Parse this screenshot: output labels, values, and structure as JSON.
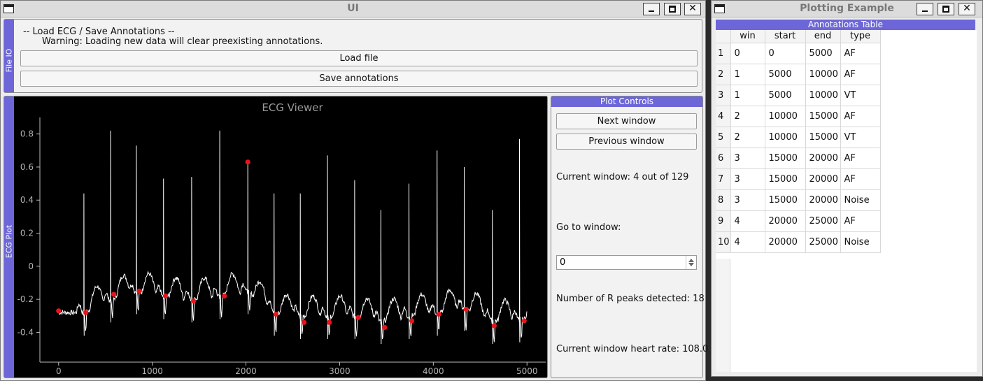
{
  "main_window": {
    "title": "UI",
    "buttons": {
      "minimize": "minimize",
      "maximize": "maximize",
      "close": "✕"
    }
  },
  "file_io": {
    "dock_title": "File IO",
    "heading": "-- Load ECG / Save Annotations --",
    "warning": "Warning: Loading new data will clear preexisting annotations.",
    "load_button": "Load file",
    "save_button": "Save annotations"
  },
  "ecg_dock": {
    "dock_title": "ECG Plot"
  },
  "plot_controls": {
    "title": "Plot Controls",
    "next_button": "Next window",
    "prev_button": "Previous window",
    "current_window": "Current window: 4 out of 129",
    "goto_label": "Go to window:",
    "goto_value": "0",
    "r_peaks": "Number of R peaks detected: 18",
    "heart_rate": "Current window heart rate: 108.0"
  },
  "side_window": {
    "title": "Plotting Example",
    "buttons": {
      "minimize": "minimize",
      "maximize": "maximize",
      "close": "✕"
    },
    "table_title": "Annotations Table",
    "columns": [
      "win",
      "start",
      "end",
      "type"
    ],
    "rows": [
      {
        "num": "1",
        "win": "0",
        "start": "0",
        "end": "5000",
        "type": "AF"
      },
      {
        "num": "2",
        "win": "1",
        "start": "5000",
        "end": "10000",
        "type": "AF"
      },
      {
        "num": "3",
        "win": "1",
        "start": "5000",
        "end": "10000",
        "type": "VT"
      },
      {
        "num": "4",
        "win": "2",
        "start": "10000",
        "end": "15000",
        "type": "AF"
      },
      {
        "num": "5",
        "win": "2",
        "start": "10000",
        "end": "15000",
        "type": "VT"
      },
      {
        "num": "6",
        "win": "3",
        "start": "15000",
        "end": "20000",
        "type": "AF"
      },
      {
        "num": "7",
        "win": "3",
        "start": "15000",
        "end": "20000",
        "type": "AF"
      },
      {
        "num": "8",
        "win": "3",
        "start": "15000",
        "end": "20000",
        "type": "Noise"
      },
      {
        "num": "9",
        "win": "4",
        "start": "20000",
        "end": "25000",
        "type": "AF"
      },
      {
        "num": "10",
        "win": "4",
        "start": "20000",
        "end": "25000",
        "type": "Noise"
      }
    ]
  },
  "chart_data": {
    "type": "line",
    "title": "ECG Viewer",
    "xlim": [
      -200,
      5200
    ],
    "ylim": [
      -0.58,
      0.9
    ],
    "xticks": [
      0,
      1000,
      2000,
      3000,
      4000,
      5000
    ],
    "yticks": [
      -0.4,
      -0.2,
      0,
      0.2,
      0.4,
      0.6,
      0.8
    ],
    "ytick_labels": [
      "-0.4",
      "-0.2",
      "0",
      "0.2",
      "0.4",
      "0.6",
      "0.8"
    ],
    "series_color": "#ffffff",
    "peak_color": "#e8141c",
    "beats": [
      {
        "x": 270,
        "peak": 0.44,
        "base": -0.28
      },
      {
        "x": 555,
        "peak": 0.82,
        "base": -0.2
      },
      {
        "x": 830,
        "peak": 0.73,
        "base": -0.15
      },
      {
        "x": 1120,
        "peak": 0.53,
        "base": -0.18
      },
      {
        "x": 1420,
        "peak": 0.54,
        "base": -0.2
      },
      {
        "x": 1720,
        "peak": 0.82,
        "base": -0.18
      },
      {
        "x": 2020,
        "peak": 0.62,
        "base": -0.15
      },
      {
        "x": 2300,
        "peak": 0.44,
        "base": -0.28
      },
      {
        "x": 2580,
        "peak": 0.44,
        "base": -0.3
      },
      {
        "x": 2870,
        "peak": 0.67,
        "base": -0.3
      },
      {
        "x": 3160,
        "peak": 0.52,
        "base": -0.3
      },
      {
        "x": 3440,
        "peak": 0.34,
        "base": -0.33
      },
      {
        "x": 3740,
        "peak": 0.5,
        "base": -0.3
      },
      {
        "x": 4040,
        "peak": 0.7,
        "base": -0.28
      },
      {
        "x": 4330,
        "peak": 0.6,
        "base": -0.25
      },
      {
        "x": 4630,
        "peak": 0.34,
        "base": -0.33
      },
      {
        "x": 4920,
        "peak": 0.77,
        "base": -0.32
      }
    ],
    "r_peaks": [
      {
        "x": 0,
        "y": -0.27
      },
      {
        "x": 290,
        "y": -0.28
      },
      {
        "x": 590,
        "y": -0.17
      },
      {
        "x": 860,
        "y": -0.15
      },
      {
        "x": 1140,
        "y": -0.18
      },
      {
        "x": 1440,
        "y": -0.21
      },
      {
        "x": 1770,
        "y": -0.18
      },
      {
        "x": 2020,
        "y": 0.63
      },
      {
        "x": 2320,
        "y": -0.29
      },
      {
        "x": 2620,
        "y": -0.34
      },
      {
        "x": 2890,
        "y": -0.34
      },
      {
        "x": 3200,
        "y": -0.31
      },
      {
        "x": 3480,
        "y": -0.37
      },
      {
        "x": 3770,
        "y": -0.33
      },
      {
        "x": 4060,
        "y": -0.29
      },
      {
        "x": 4350,
        "y": -0.26
      },
      {
        "x": 4650,
        "y": -0.36
      },
      {
        "x": 4970,
        "y": -0.33
      }
    ]
  }
}
